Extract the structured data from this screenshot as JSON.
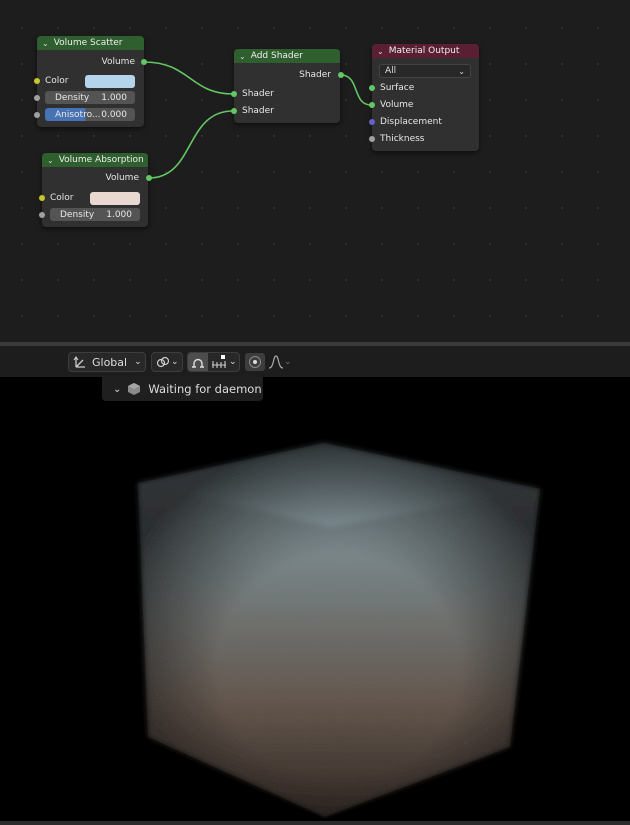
{
  "nodes": {
    "volume_scatter": {
      "title": "Volume Scatter",
      "output": "Volume",
      "color_label": "Color",
      "density_label": "Density",
      "density_value": "1.000",
      "anisotropy_label": "Anisotro...",
      "anisotropy_value": "0.000",
      "color_swatch": "#b3d4ea"
    },
    "volume_absorption": {
      "title": "Volume Absorption",
      "output": "Volume",
      "color_label": "Color",
      "density_label": "Density",
      "density_value": "1.000",
      "color_swatch": "#e8d8d0"
    },
    "add_shader": {
      "title": "Add Shader",
      "output": "Shader",
      "input1": "Shader",
      "input2": "Shader"
    },
    "material_output": {
      "title": "Material Output",
      "target": "All",
      "surface": "Surface",
      "volume": "Volume",
      "displacement": "Displacement",
      "thickness": "Thickness"
    }
  },
  "viewport": {
    "orientation": "Global",
    "status": "Waiting for daemon"
  },
  "icons": {
    "transform": "transform-orientation-icon",
    "pivot": "link-icon",
    "snap": "snap-icon",
    "snap_target": "snap-increment-icon",
    "proportional": "proportional-edit-icon",
    "falloff": "falloff-curve-icon",
    "daemon": "render-daemon-icon"
  },
  "colors": {
    "header_green": "#2f5f2f",
    "header_red": "#5a1f32",
    "link_green": "#63c763",
    "socket_yellow": "#c7c729",
    "socket_purple": "#6363c7"
  }
}
